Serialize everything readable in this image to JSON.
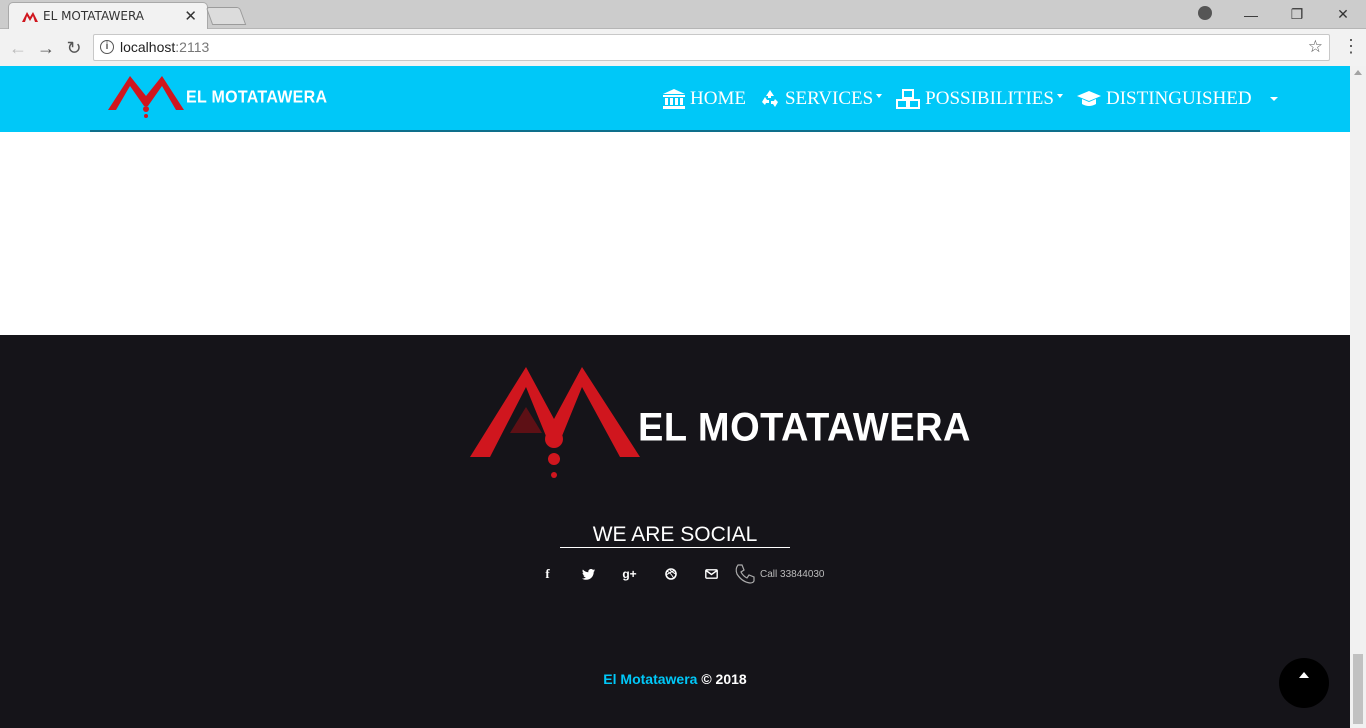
{
  "browser": {
    "tab_title": "EL MOTATAWERA",
    "url_host": "localhost",
    "url_port": ":2113"
  },
  "navbar": {
    "brand": "EL MOTATAWERA",
    "items": [
      {
        "label": "HOME",
        "icon": "bank-icon",
        "has_caret": false
      },
      {
        "label": "SERVICES",
        "icon": "recycle-icon",
        "has_caret": true
      },
      {
        "label": "POSSIBILITIES",
        "icon": "cubes-icon",
        "has_caret": true
      },
      {
        "label": "DISTINGUISHED",
        "icon": "graduation-cap-icon",
        "has_caret": false
      }
    ],
    "bg_color": "#00c8f8"
  },
  "footer": {
    "brand": "EL MOTATAWERA",
    "social_title": "WE ARE SOCIAL",
    "social_icons": [
      "facebook-icon",
      "twitter-icon",
      "google-plus-icon",
      "dribbble-icon",
      "envelope-icon"
    ],
    "call_text": "Call 33844030",
    "copyright_brand": "El Motatawera",
    "copyright_rest": " © 2018",
    "bg_color": "#151419",
    "logo_color": "#d0161e"
  }
}
